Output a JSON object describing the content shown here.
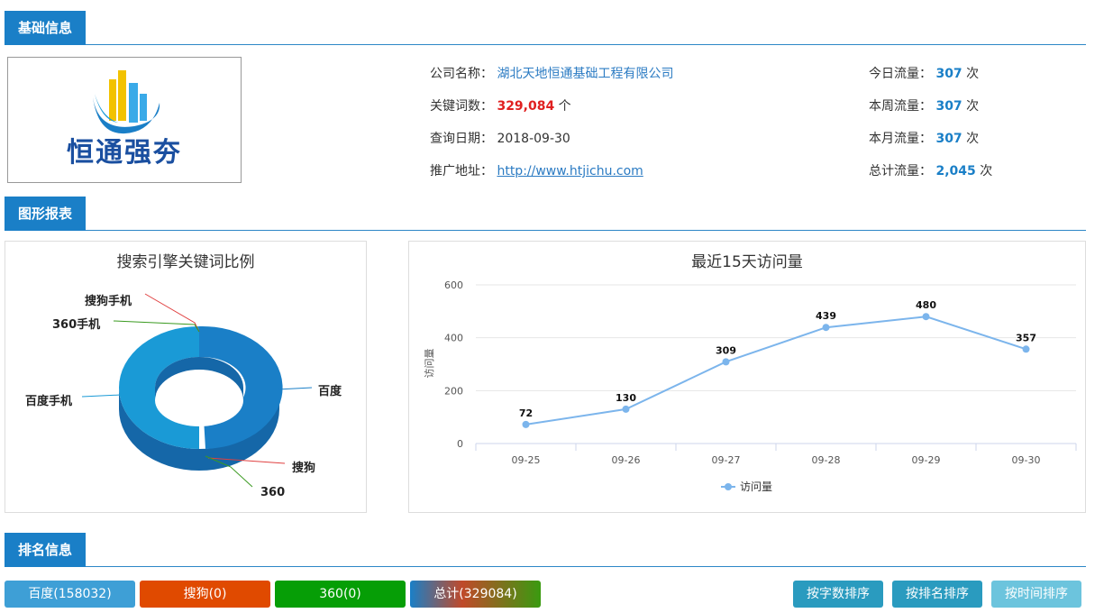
{
  "sections": {
    "basic": "基础信息",
    "charts": "图形报表",
    "ranking": "排名信息"
  },
  "logo": {
    "text": "恒通强夯"
  },
  "info": {
    "company_label": "公司名称：",
    "company_value": "湖北天地恒通基础工程有限公司",
    "keywords_label": "关键词数：",
    "keywords_value": "329,084",
    "keywords_unit": "个",
    "date_label": "查询日期：",
    "date_value": "2018-09-30",
    "url_label": "推广地址：",
    "url_value": "http://www.htjichu.com"
  },
  "traffic": {
    "unit": "次",
    "today_label": "今日流量：",
    "today_value": "307",
    "week_label": "本周流量：",
    "week_value": "307",
    "month_label": "本月流量：",
    "month_value": "307",
    "total_label": "总计流量：",
    "total_value": "2,045"
  },
  "chart_data": [
    {
      "type": "pie",
      "title": "搜索引擎关键词比例",
      "categories": [
        "百度",
        "搜狗",
        "360",
        "百度手机",
        "360手机",
        "搜狗手机"
      ],
      "values": [
        158032,
        0,
        0,
        171052,
        0,
        0
      ],
      "colors": {
        "baidu": "#1a7fc7",
        "baidu_mobile": "#1a9ad6"
      }
    },
    {
      "type": "line",
      "title": "最近15天访问量",
      "ylabel": "访问量",
      "x": [
        "09-25",
        "09-26",
        "09-27",
        "09-28",
        "09-29",
        "09-30"
      ],
      "series": [
        {
          "name": "访问量",
          "values": [
            72,
            130,
            309,
            439,
            480,
            357
          ]
        }
      ],
      "ylim": [
        0,
        600
      ],
      "yticks": [
        "0",
        "200",
        "400",
        "600"
      ],
      "grid": true,
      "legend": "bottom",
      "color": "#7cb5ec"
    }
  ],
  "buttons": {
    "baidu": "百度(158032)",
    "sogou": "搜狗(0)",
    "s360": "360(0)",
    "total": "总计(329084)",
    "sort_words": "按字数排序",
    "sort_rank": "按排名排序",
    "sort_time": "按时间排序"
  },
  "colors": {
    "accent": "#1a7fc7",
    "baidu_btn": "#3e9fd6",
    "sogou_btn": "#e04a00",
    "s360_btn": "#069e06",
    "sort_btn": "#2a9bbf",
    "sort_btn_light": "#6cc4dd"
  }
}
